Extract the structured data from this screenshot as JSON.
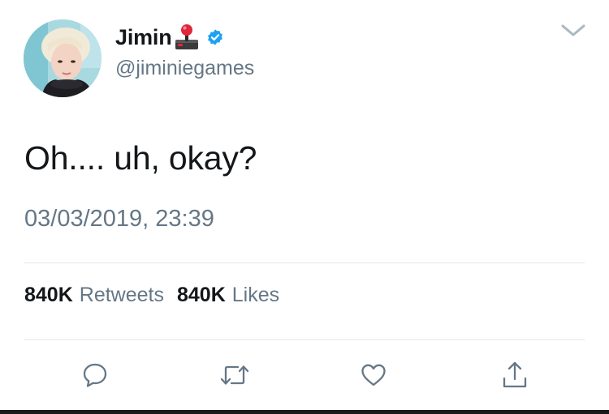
{
  "user": {
    "display_name": "Jimin",
    "name_emoji_icon": "joystick-icon",
    "verified": true,
    "handle": "@jiminiegames"
  },
  "tweet": {
    "text": "Oh.... uh, okay?",
    "timestamp": "03/03/2019, 23:39"
  },
  "stats": {
    "retweets_count": "840K",
    "retweets_label": "Retweets",
    "likes_count": "840K",
    "likes_label": "Likes"
  },
  "actions": [
    "reply-icon",
    "retweet-icon",
    "like-icon",
    "share-icon"
  ],
  "colors": {
    "text_primary": "#14171a",
    "text_secondary": "#657786",
    "verified_blue": "#1da1f2",
    "divider": "#e1e8ed",
    "icon_gray": "#657786"
  }
}
